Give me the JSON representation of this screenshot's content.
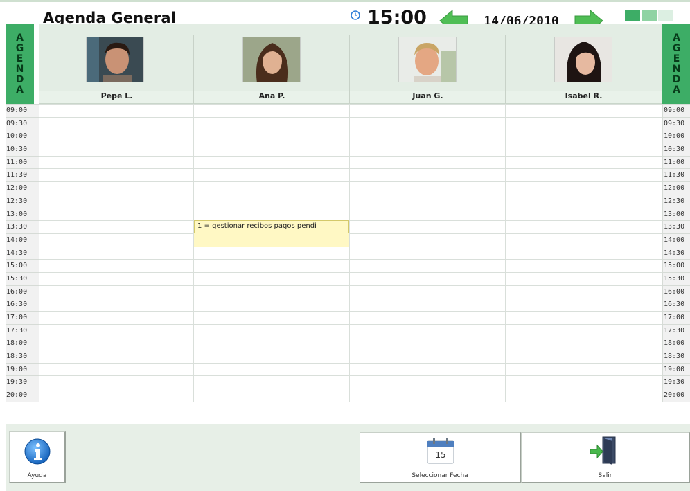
{
  "header": {
    "title": "Agenda General",
    "time": "15:00",
    "date": "14/06/2010",
    "clock_icon": "clock-icon",
    "prev_icon": "arrow-left-icon",
    "next_icon": "arrow-right-icon"
  },
  "side_tabs": {
    "left_letters": [
      "A",
      "G",
      "E",
      "N",
      "D",
      "A"
    ],
    "right_letters": [
      "A",
      "G",
      "E",
      "N",
      "D",
      "A"
    ]
  },
  "staff": [
    {
      "name": "Pepe L."
    },
    {
      "name": "Ana P."
    },
    {
      "name": "Juan G."
    },
    {
      "name": "Isabel R."
    }
  ],
  "time_slots": [
    "09:00",
    "09:30",
    "10:00",
    "10:30",
    "11:00",
    "11:30",
    "12:00",
    "12:30",
    "13:00",
    "13:30",
    "14:00",
    "14:30",
    "15:00",
    "15:30",
    "16:00",
    "16:30",
    "17:00",
    "17:30",
    "18:00",
    "18:30",
    "19:00",
    "19:30",
    "20:00"
  ],
  "right_time_slots": [
    "09:00",
    "09:30",
    "10:00",
    "10:30",
    "11:00",
    "11:30",
    "12:00",
    "12:30",
    "13:00",
    "13:30",
    "14:00",
    "14:30",
    "15:00",
    "15:30",
    "16:00",
    "16:30",
    "17:00",
    "17:30",
    "18:00",
    "18:30",
    "19:00",
    "19:30",
    "20:00"
  ],
  "appointments": [
    {
      "staff": "Ana P.",
      "start": "13:30",
      "end": "14:30",
      "text": "1 = gestionar recibos pagos pendi"
    }
  ],
  "footer": {
    "help_label": "Ayuda",
    "select_date_label": "Seleccionar Fecha",
    "exit_label": "Salir",
    "calendar_day": "15"
  },
  "colors": {
    "accent_green": "#3dad66",
    "appointment_yellow": "#fff8c4",
    "header_band": "#e3ede4"
  }
}
